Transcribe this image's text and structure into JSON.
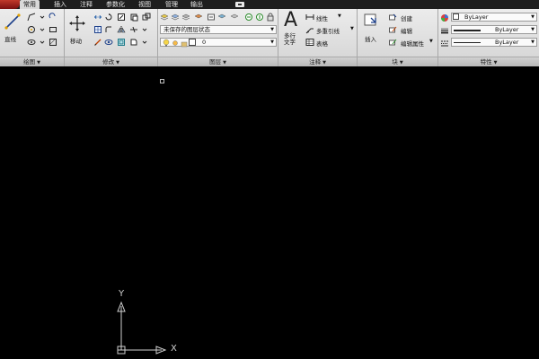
{
  "tabs": [
    "常用",
    "插入",
    "注释",
    "参数化",
    "视图",
    "管理",
    "输出"
  ],
  "active_tab": "常用",
  "panels": {
    "draw": {
      "title": "绘图",
      "line_label": "直线"
    },
    "modify": {
      "title": "修改",
      "move_label": "移动"
    },
    "layers": {
      "title": "图层",
      "layer_state": "未保存的图层状态",
      "current_layer": "0"
    },
    "annotation": {
      "title": "注释",
      "mtext_label": "多行\n文字",
      "linear_label": "线性",
      "mleader_label": "多重引线",
      "table_label": "表格"
    },
    "block": {
      "title": "块",
      "insert_label": "插入",
      "create_label": "创建",
      "edit_label": "编辑",
      "edit_attr_label": "编辑属性"
    },
    "properties": {
      "title": "特性",
      "color": "ByLayer",
      "linetype": "ByLayer",
      "lineweight": "ByLayer"
    }
  },
  "ucs": {
    "x_label": "X",
    "y_label": "Y"
  },
  "colors": {
    "tabbar": "#1e1e1e",
    "ribbon": "#e0e0e0",
    "canvas": "#000000",
    "app_button": "#b22222"
  }
}
